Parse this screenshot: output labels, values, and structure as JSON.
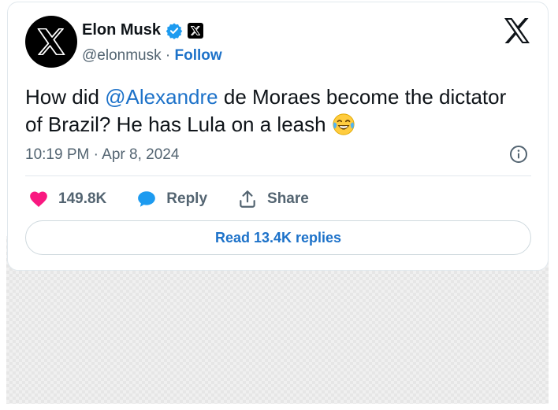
{
  "author": {
    "name": "Elon Musk",
    "handle": "@elonmusk",
    "separator": " · ",
    "follow_label": "Follow"
  },
  "tweet": {
    "text_before": "How did ",
    "mention": "@Alexandre",
    "text_after": " de Moraes become the dictator of Brazil? He has Lula on a leash ",
    "emoji": "face-with-tears-of-joy",
    "timestamp": "10:19 PM · Apr 8, 2024"
  },
  "actions": {
    "likes": "149.8K",
    "reply_label": "Reply",
    "share_label": "Share"
  },
  "read_replies_label": "Read 13.4K replies",
  "colors": {
    "link": "#1d72c9",
    "heart": "#f91880",
    "reply_bubble": "#1d9bf0",
    "verified": "#1d9bf0",
    "text": "#0f1419",
    "secondary": "#536471"
  },
  "icons": {
    "avatar": "x-logo-avatar",
    "verified": "verified-badge-icon",
    "org": "x-org-badge-icon",
    "brand": "x-logo-icon",
    "info": "info-icon",
    "like": "heart-icon",
    "reply": "speech-bubble-icon",
    "share": "share-upload-icon"
  }
}
